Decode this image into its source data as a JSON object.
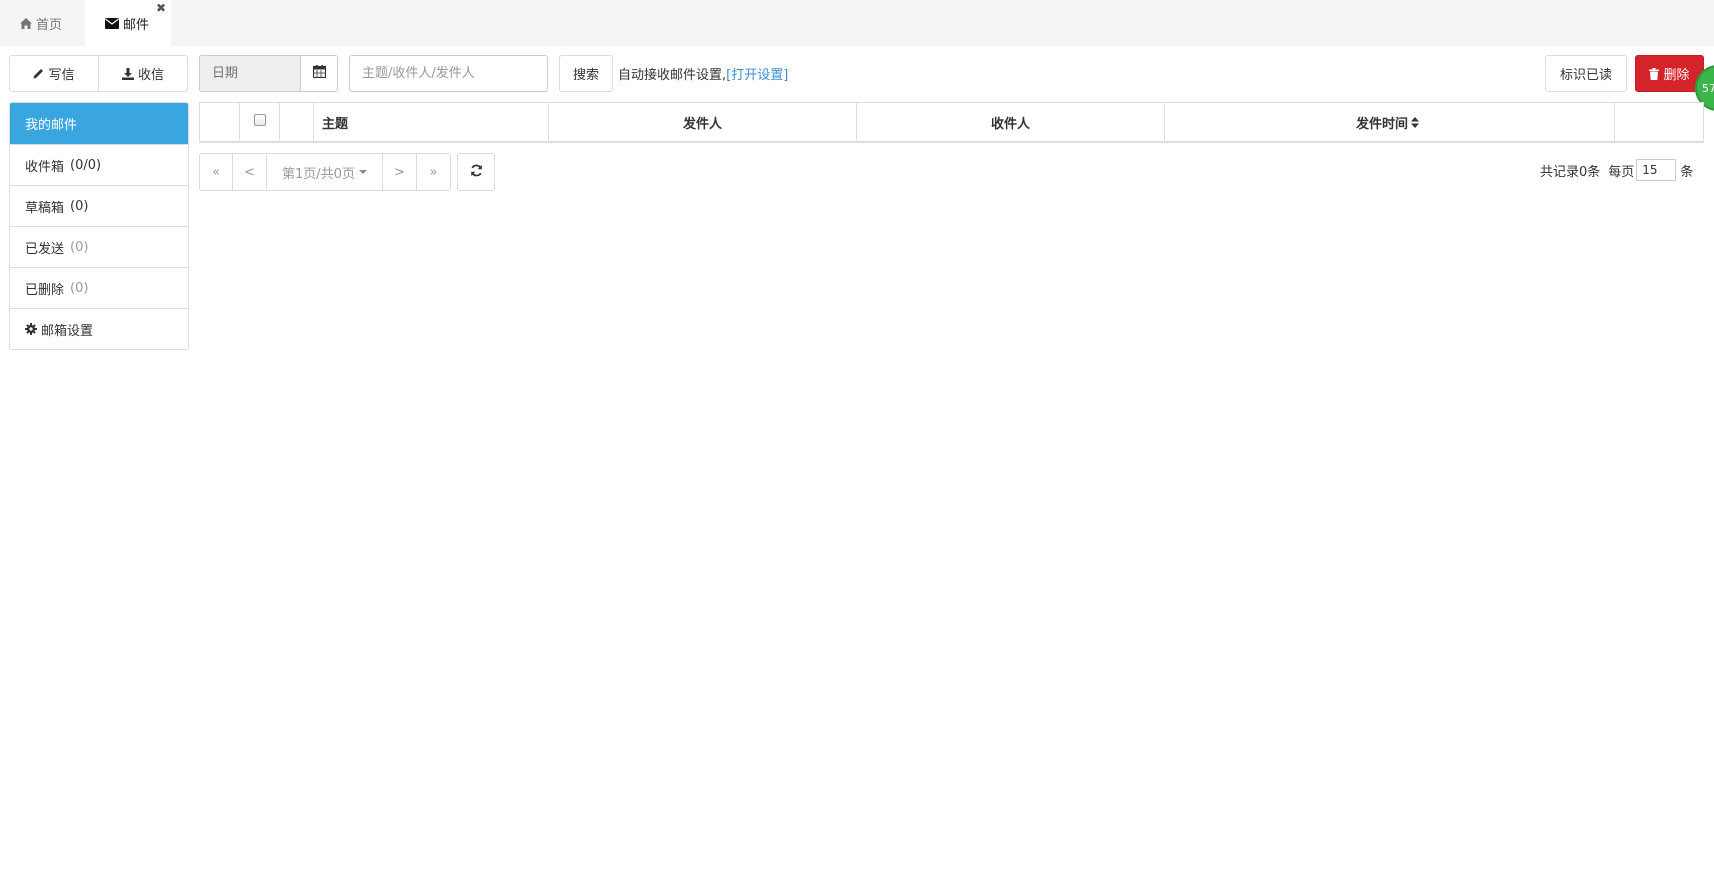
{
  "tabs": [
    {
      "label": "首页",
      "icon": "home-icon"
    },
    {
      "label": "邮件",
      "icon": "envelope-icon",
      "active": true,
      "close": "✖"
    }
  ],
  "actions": {
    "compose_label": "写信",
    "receive_label": "收信"
  },
  "toolbar": {
    "date_placeholder": "日期",
    "search_placeholder": "主题/收件人/发件人",
    "search_label": "搜索",
    "auto_receive_text": "自动接收邮件设置,",
    "open_settings_link": "[打开设置]",
    "mark_read_label": "标识已读",
    "delete_label": "删除",
    "float_badge": "57"
  },
  "sidebar": {
    "header": "我的邮件",
    "items": [
      {
        "label": "收件箱",
        "count": "(0/0)"
      },
      {
        "label": "草稿箱",
        "count": "(0)"
      },
      {
        "label": "已发送",
        "count": "(0)"
      },
      {
        "label": "已删除",
        "count": "(0)"
      },
      {
        "label": "邮箱设置",
        "icon": "gear-icon"
      }
    ]
  },
  "table": {
    "columns": [
      "",
      "",
      "",
      "主题",
      "发件人",
      "收件人",
      "发件时间",
      ""
    ],
    "rows": []
  },
  "pager": {
    "first": "«",
    "prev": "<",
    "page_info": "第1页/共0页",
    "next": ">",
    "last": "»",
    "total_text": "共记录0条",
    "per_page_label": "每页",
    "per_page_value": "15",
    "per_page_unit": "条"
  },
  "colors": {
    "primary_blue": "#3aa6e0",
    "danger_red": "#d4232b",
    "link_blue": "#3a8ed3",
    "badge_green": "#3cb54a"
  }
}
